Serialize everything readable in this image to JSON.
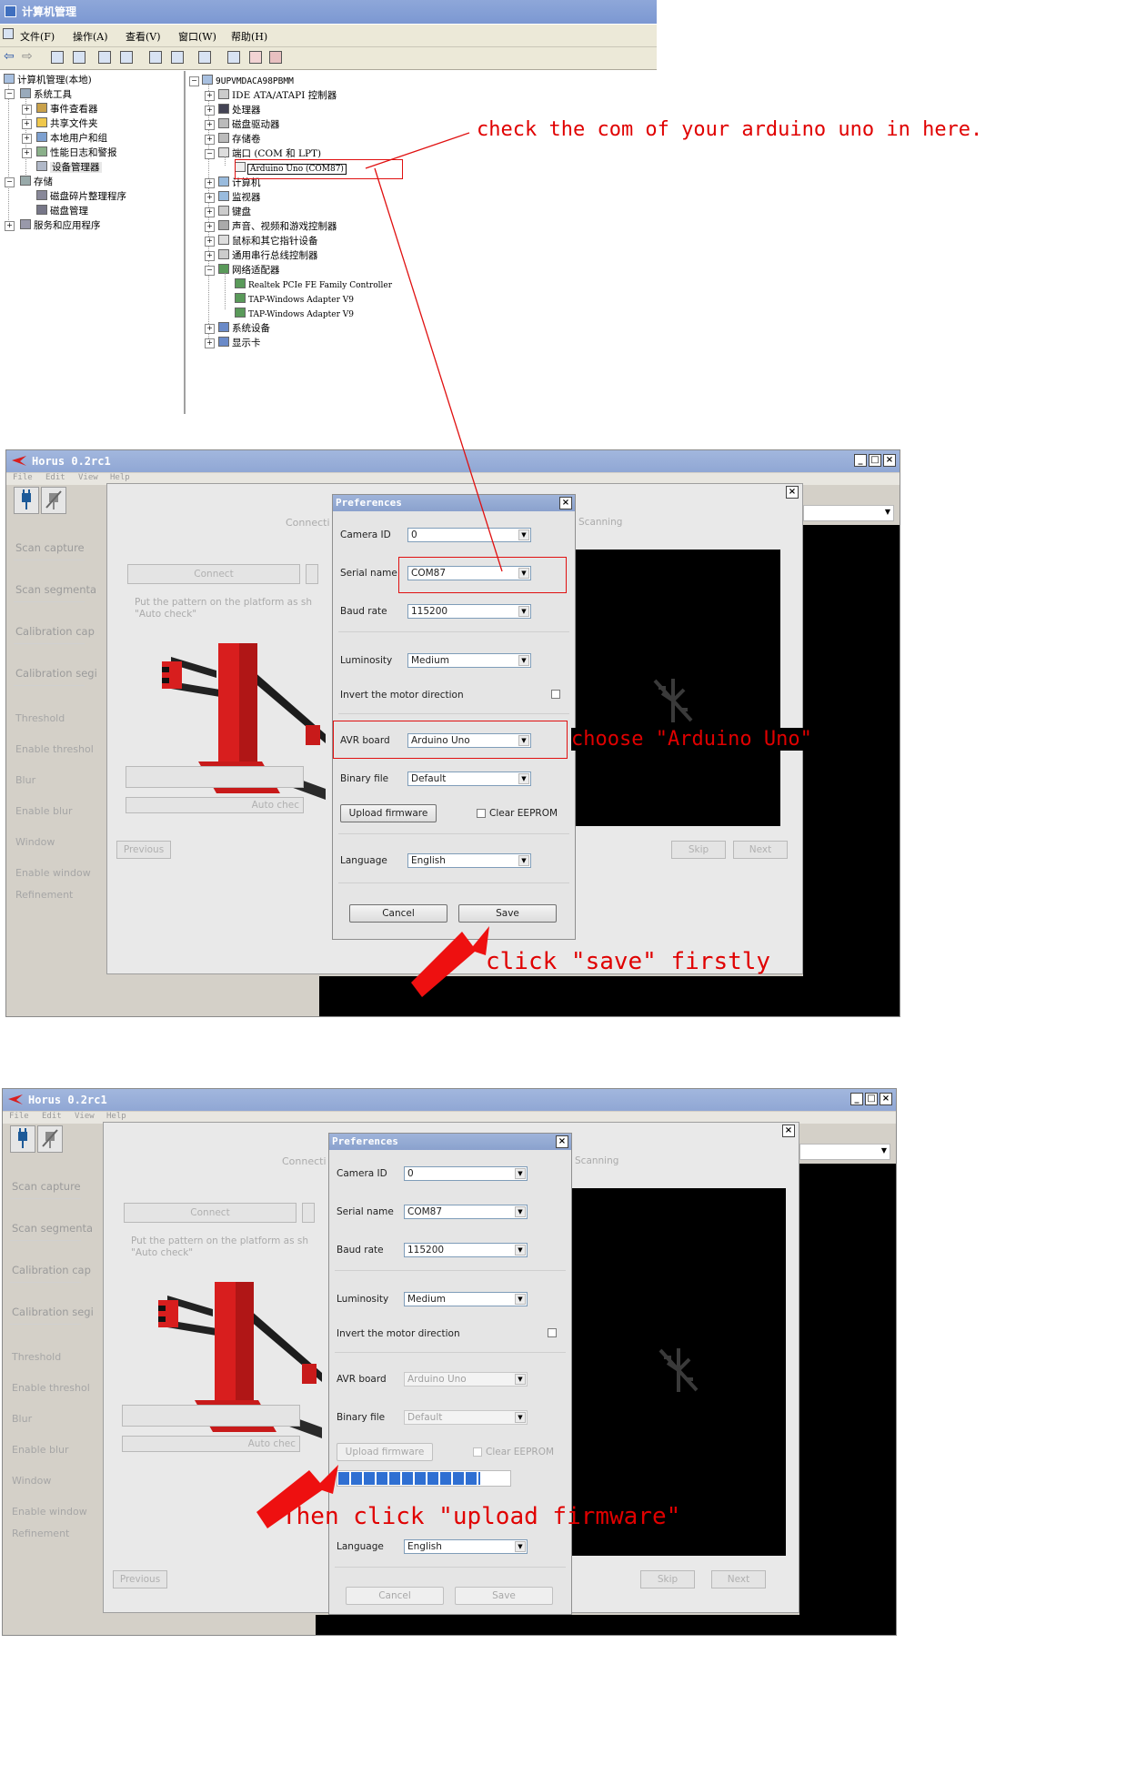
{
  "cm": {
    "title": "计算机管理",
    "menu": [
      "文件(F)",
      "操作(A)",
      "查看(V)",
      "窗口(W)",
      "帮助(H)"
    ],
    "left_tree": [
      "计算机管理(本地)",
      "系统工具",
      "事件查看器",
      "共享文件夹",
      "本地用户和组",
      "性能日志和警报",
      "设备管理器",
      "存储",
      "磁盘碎片整理程序",
      "磁盘管理",
      "服务和应用程序"
    ],
    "right_tree": {
      "root": "9UPVMDACA98PBMM",
      "items": [
        "IDE ATA/ATAPI 控制器",
        "处理器",
        "磁盘驱动器",
        "存储卷",
        "端口 (COM 和 LPT)"
      ],
      "selected": "Arduino Uno (COM87)",
      "items2": [
        "计算机",
        "监视器",
        "键盘",
        "声音、视频和游戏控制器",
        "鼠标和其它指针设备",
        "通用串行总线控制器",
        "网络适配器"
      ],
      "net": [
        "Realtek PCIe FE Family Controller",
        "TAP-Windows Adapter V9",
        "TAP-Windows Adapter V9"
      ],
      "items3": [
        "系统设备",
        "显示卡"
      ]
    }
  },
  "annotations": {
    "check": "check the com of your arduino uno in here.",
    "choose": "choose \"Arduino Uno\"",
    "save": "click \"save\" firstly",
    "upload": "Then click \"upload firmware\""
  },
  "horus": {
    "title": "Horus 0.2rc1",
    "menu": [
      "File",
      "Edit",
      "View",
      "Help"
    ],
    "wizard_left": [
      "Scan capture",
      "Scan segmenta",
      "Calibration cap",
      "Calibration segi",
      "Threshold",
      "Enable threshol",
      "Blur",
      "Enable blur",
      "Window",
      "Enable window",
      "Refinement"
    ],
    "connect_header": "Connecti",
    "connect_btn": "Connect",
    "pattern_text_1": "Put the pattern on the platform as sh",
    "pattern_text_2": "\"Auto check\"",
    "auto_check": "Auto chec",
    "previous": "Previous",
    "skip": "Skip",
    "next": "Next",
    "scanning": "Scanning"
  },
  "prefs": {
    "title": "Preferences",
    "camera_id_label": "Camera ID",
    "camera_id": "0",
    "serial_label": "Serial name",
    "serial": "COM87",
    "baud_label": "Baud rate",
    "baud": "115200",
    "lum_label": "Luminosity",
    "lum": "Medium",
    "invert_label": "Invert the motor direction",
    "avr_label": "AVR board",
    "avr": "Arduino Uno",
    "binary_label": "Binary file",
    "binary": "Default",
    "upload": "Upload firmware",
    "clear_eeprom": "Clear EEPROM",
    "lang_label": "Language",
    "lang": "English",
    "cancel": "Cancel",
    "save": "Save"
  },
  "upload_progress": 0.82,
  "colors": {
    "annotation": "#e00000",
    "title_blue": "#8ea7d9",
    "robot_red": "#d81e1e"
  }
}
